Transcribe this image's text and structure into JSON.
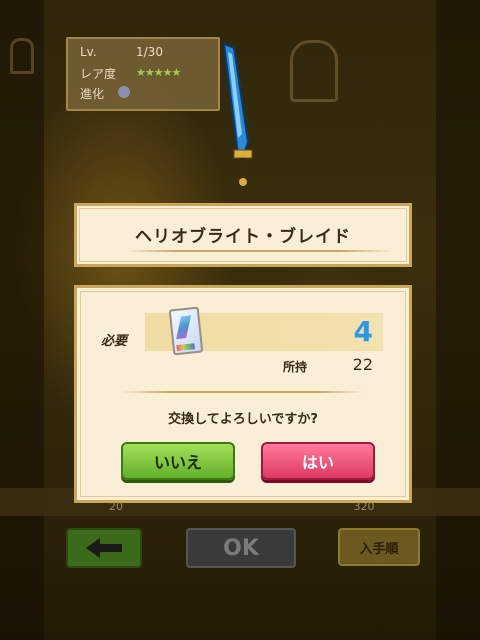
{
  "info_panel": {
    "level_label": "Lv.",
    "level_value": "1/30",
    "rarity_label": "レア度",
    "rarity_stars": "★★★★★",
    "evolution_label": "進化"
  },
  "dialog": {
    "item_name": "ヘリオブライト・ブレイド",
    "required_label": "必要",
    "required_count": "4",
    "owned_label": "所持",
    "owned_count": "22",
    "question": "交換してよろしいですか?",
    "no_label": "いいえ",
    "yes_label": "はい"
  },
  "bottom_strip": {
    "left_value": "20",
    "right_value": "320"
  },
  "bottom_bar": {
    "ok_label": "OK",
    "obtain_order_label": "入手順"
  },
  "colors": {
    "dialog_bg": "#f8efd6",
    "dialog_border": "#c9a65a",
    "required_number": "#2a9ae8",
    "yes_button": "#e03a62",
    "no_button": "#64b02a"
  }
}
